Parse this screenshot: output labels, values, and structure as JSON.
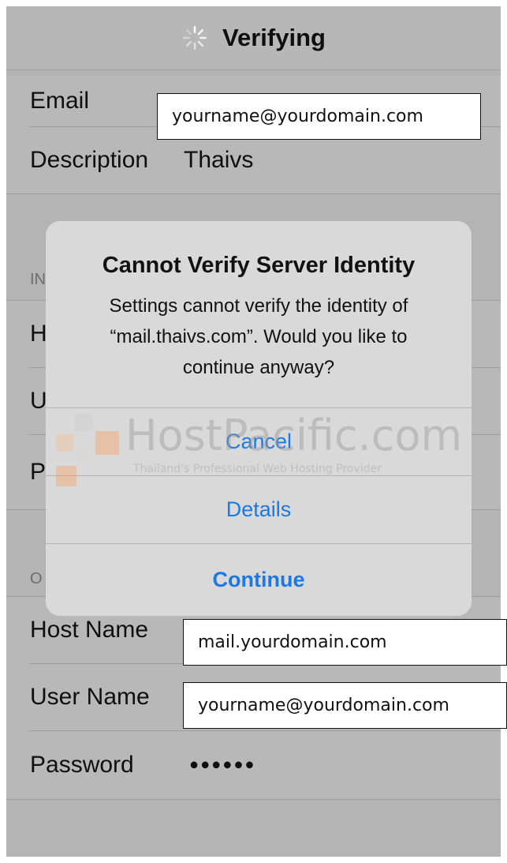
{
  "nav": {
    "title": "Verifying"
  },
  "account": {
    "email_label": "Email",
    "email_value": "yourname@yourdomain.com",
    "description_label": "Description",
    "description_value": "Thaivs"
  },
  "incoming_section": {
    "header_partial": "IN",
    "host_initial": "H",
    "user_initial": "U",
    "password_initial": "P"
  },
  "outgoing_section": {
    "header_partial": "O",
    "host_label": "Host Name",
    "host_value": "mail.yourdomain.com",
    "user_label": "User Name",
    "user_value": "yourname@yourdomain.com",
    "password_label": "Password",
    "password_dots": "●●●●●●"
  },
  "alert": {
    "title": "Cannot Verify Server Identity",
    "message": "Settings cannot verify the identity of “mail.thaivs.com”. Would you like to continue anyway?",
    "buttons": {
      "cancel": "Cancel",
      "details": "Details",
      "continue": "Continue"
    }
  },
  "watermark": {
    "brand": "HostPacific.com",
    "tagline": "Thailand's Professional Web Hosting Provider"
  },
  "colors": {
    "ios_blue": "#1a79e6",
    "dim_background": "#b4b4b4",
    "alert_background": "#d9d9d9",
    "watermark_orange": "#f2a66b"
  }
}
